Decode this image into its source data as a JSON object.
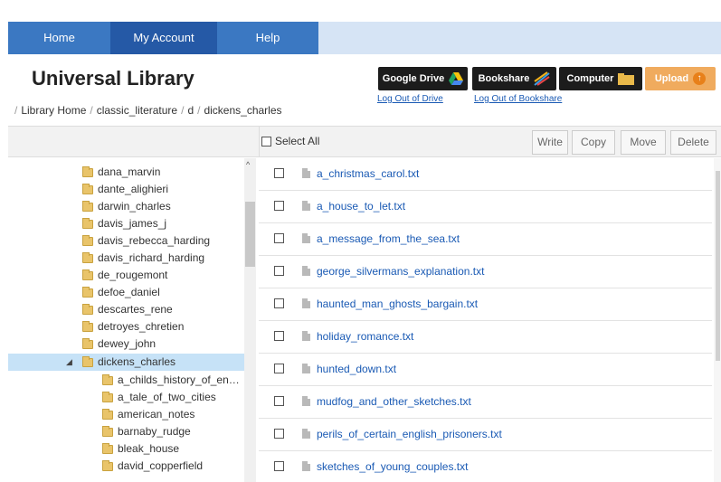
{
  "nav": {
    "tabs": [
      {
        "label": "Home"
      },
      {
        "label": "My Account"
      },
      {
        "label": "Help"
      }
    ]
  },
  "header": {
    "title": "Universal Library",
    "breadcrumb": [
      "Library Home",
      "classic_literature",
      "d",
      "dickens_charles"
    ]
  },
  "services": {
    "drive_label": "Google Drive",
    "bookshare_label": "Bookshare",
    "computer_label": "Computer",
    "upload_label": "Upload",
    "drive_logout": "Log Out of Drive",
    "bookshare_logout": "Log Out of Bookshare"
  },
  "toolbar": {
    "select_all": "Select All",
    "write": "Write",
    "copy": "Copy",
    "move": "Move",
    "delete": "Delete"
  },
  "tree": {
    "items": [
      {
        "label": "dana_marvin"
      },
      {
        "label": "dante_alighieri"
      },
      {
        "label": "darwin_charles"
      },
      {
        "label": "davis_james_j"
      },
      {
        "label": "davis_rebecca_harding"
      },
      {
        "label": "davis_richard_harding"
      },
      {
        "label": "de_rougemont"
      },
      {
        "label": "defoe_daniel"
      },
      {
        "label": "descartes_rene"
      },
      {
        "label": "detroyes_chretien"
      },
      {
        "label": "dewey_john"
      },
      {
        "label": "dickens_charles"
      },
      {
        "label": "a_childs_history_of_en…"
      },
      {
        "label": "a_tale_of_two_cities"
      },
      {
        "label": "american_notes"
      },
      {
        "label": "barnaby_rudge"
      },
      {
        "label": "bleak_house"
      },
      {
        "label": "david_copperfield"
      }
    ]
  },
  "files": {
    "items": [
      {
        "name": "a_christmas_carol.txt"
      },
      {
        "name": "a_house_to_let.txt"
      },
      {
        "name": "a_message_from_the_sea.txt"
      },
      {
        "name": "george_silvermans_explanation.txt"
      },
      {
        "name": "haunted_man_ghosts_bargain.txt"
      },
      {
        "name": "holiday_romance.txt"
      },
      {
        "name": "hunted_down.txt"
      },
      {
        "name": "mudfog_and_other_sketches.txt"
      },
      {
        "name": "perils_of_certain_english_prisoners.txt"
      },
      {
        "name": "sketches_of_young_couples.txt"
      }
    ]
  }
}
